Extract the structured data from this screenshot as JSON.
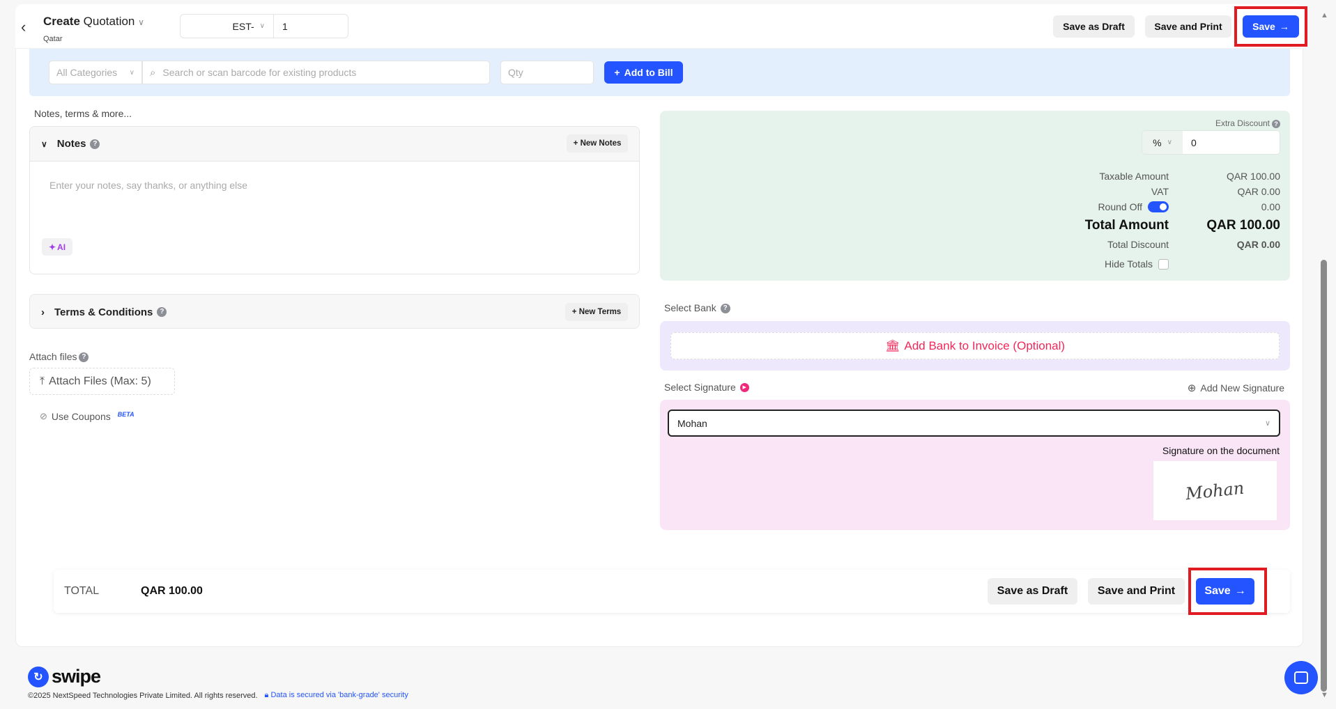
{
  "header": {
    "title_bold": "Create",
    "title_rest": "Quotation",
    "subtitle": "Qatar",
    "prefix": "EST-",
    "number": "1",
    "save_draft": "Save as Draft",
    "save_print": "Save and Print",
    "save": "Save"
  },
  "product_bar": {
    "category": "All Categories",
    "search_placeholder": "Search or scan barcode for existing products",
    "qty_placeholder": "Qty",
    "add_label": "Add to Bill"
  },
  "notes_section": {
    "heading": "Notes, terms & more...",
    "notes_title": "Notes",
    "new_notes": "New Notes",
    "notes_placeholder": "Enter your notes, say thanks, or anything else",
    "ai_label": "AI",
    "terms_title": "Terms & Conditions",
    "new_terms": "New Terms",
    "attach_label": "Attach files",
    "attach_button": "Attach Files (Max: 5)",
    "coupons": "Use Coupons",
    "beta": "BETA"
  },
  "summary": {
    "extra_discount_label": "Extra Discount",
    "discount_type": "%",
    "discount_value": "0",
    "taxable_label": "Taxable Amount",
    "taxable_value": "QAR 100.00",
    "vat_label": "VAT",
    "vat_value": "QAR 0.00",
    "roundoff_label": "Round Off",
    "roundoff_value": "0.00",
    "roundoff_enabled": true,
    "total_label": "Total Amount",
    "total_value": "QAR 100.00",
    "discount_label": "Total Discount",
    "discount_total": "QAR 0.00",
    "hide_totals_label": "Hide Totals",
    "hide_totals": false
  },
  "bank": {
    "label": "Select Bank",
    "add": "Add Bank to Invoice (Optional)"
  },
  "signature": {
    "label": "Select Signature",
    "add_new": "Add New Signature",
    "selected": "Mohan",
    "doc_label": "Signature on the document",
    "signature_text": "Mohan"
  },
  "footer_bar": {
    "total_label": "TOTAL",
    "total_value": "QAR 100.00",
    "save_draft": "Save as Draft",
    "save_print": "Save and Print",
    "save": "Save"
  },
  "footer": {
    "brand": "swipe",
    "copyright": "©2025 NextSpeed Technologies Private Limited. All rights reserved.",
    "security": "Data is secured via 'bank-grade' security"
  },
  "colors": {
    "primary": "#2454ff",
    "bank_accent": "#f0285a",
    "highlight": "#e11b22"
  }
}
